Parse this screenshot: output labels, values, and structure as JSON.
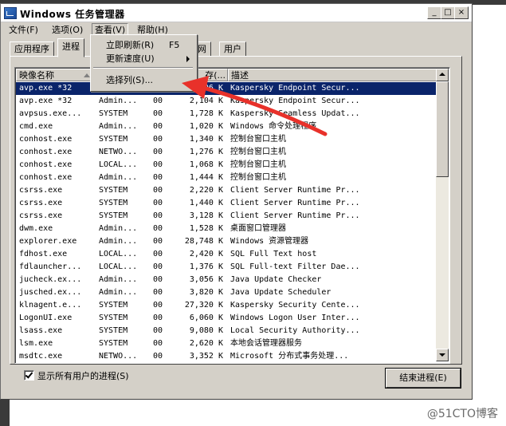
{
  "window": {
    "title": "Windows 任务管理器",
    "controls": {
      "minimize": "_",
      "maximize": "□",
      "close": "×"
    }
  },
  "menubar": [
    {
      "label": "文件(F)"
    },
    {
      "label": "选项(O)"
    },
    {
      "label": "查看(V)"
    },
    {
      "label": "帮助(H)"
    }
  ],
  "view_menu": {
    "refresh_label": "立即刷新(R)",
    "refresh_shortcut": "F5",
    "speed_label": "更新速度(U)",
    "select_columns_label": "选择列(S)..."
  },
  "tabs": [
    {
      "label": "应用程序"
    },
    {
      "label": "进程"
    },
    {
      "label": "网"
    },
    {
      "label": "用户"
    }
  ],
  "columns": {
    "name": "映像名称",
    "memory": "存(...",
    "description": "描述"
  },
  "rows": [
    {
      "name": "avp.exe *32",
      "user": "SYSTEM",
      "cpu": "00",
      "mem": "...,206 K",
      "desc": "Kaspersky Endpoint Secur..."
    },
    {
      "name": "avp.exe *32",
      "user": "Admin...",
      "cpu": "00",
      "mem": "2,104 K",
      "desc": "Kaspersky Endpoint Secur..."
    },
    {
      "name": "avpsus.exe...",
      "user": "SYSTEM",
      "cpu": "00",
      "mem": "1,728 K",
      "desc": "Kaspersky Seamless Updat..."
    },
    {
      "name": "cmd.exe",
      "user": "Admin...",
      "cpu": "00",
      "mem": "1,020 K",
      "desc": "Windows 命令处理程序"
    },
    {
      "name": "conhost.exe",
      "user": "SYSTEM",
      "cpu": "00",
      "mem": "1,340 K",
      "desc": "控制台窗口主机"
    },
    {
      "name": "conhost.exe",
      "user": "NETWO...",
      "cpu": "00",
      "mem": "1,276 K",
      "desc": "控制台窗口主机"
    },
    {
      "name": "conhost.exe",
      "user": "LOCAL...",
      "cpu": "00",
      "mem": "1,068 K",
      "desc": "控制台窗口主机"
    },
    {
      "name": "conhost.exe",
      "user": "Admin...",
      "cpu": "00",
      "mem": "1,444 K",
      "desc": "控制台窗口主机"
    },
    {
      "name": "csrss.exe",
      "user": "SYSTEM",
      "cpu": "00",
      "mem": "2,220 K",
      "desc": "Client Server Runtime Pr..."
    },
    {
      "name": "csrss.exe",
      "user": "SYSTEM",
      "cpu": "00",
      "mem": "1,440 K",
      "desc": "Client Server Runtime Pr..."
    },
    {
      "name": "csrss.exe",
      "user": "SYSTEM",
      "cpu": "00",
      "mem": "3,128 K",
      "desc": "Client Server Runtime Pr..."
    },
    {
      "name": "dwm.exe",
      "user": "Admin...",
      "cpu": "00",
      "mem": "1,528 K",
      "desc": "桌面窗口管理器"
    },
    {
      "name": "explorer.exe",
      "user": "Admin...",
      "cpu": "00",
      "mem": "28,748 K",
      "desc": "Windows 资源管理器"
    },
    {
      "name": "fdhost.exe",
      "user": "LOCAL...",
      "cpu": "00",
      "mem": "2,420 K",
      "desc": "SQL Full Text host"
    },
    {
      "name": "fdlauncher...",
      "user": "LOCAL...",
      "cpu": "00",
      "mem": "1,376 K",
      "desc": "SQL Full-text Filter Dae..."
    },
    {
      "name": "jucheck.ex...",
      "user": "Admin...",
      "cpu": "00",
      "mem": "3,056 K",
      "desc": "Java Update Checker"
    },
    {
      "name": "jusched.ex...",
      "user": "Admin...",
      "cpu": "00",
      "mem": "3,820 K",
      "desc": "Java Update Scheduler"
    },
    {
      "name": "klnagent.e...",
      "user": "SYSTEM",
      "cpu": "00",
      "mem": "27,320 K",
      "desc": "Kaspersky Security Cente..."
    },
    {
      "name": "LogonUI.exe",
      "user": "SYSTEM",
      "cpu": "00",
      "mem": "6,060 K",
      "desc": "Windows Logon User Inter..."
    },
    {
      "name": "lsass.exe",
      "user": "SYSTEM",
      "cpu": "00",
      "mem": "9,080 K",
      "desc": "Local Security Authority..."
    },
    {
      "name": "lsm.exe",
      "user": "SYSTEM",
      "cpu": "00",
      "mem": "2,620 K",
      "desc": "本地会话管理器服务"
    },
    {
      "name": "msdtc.exe",
      "user": "NETWO...",
      "cpu": "00",
      "mem": "3,352 K",
      "desc": "Microsoft 分布式事务处理..."
    }
  ],
  "show_all_users": {
    "label": "显示所有用户的进程(S)",
    "checked": true
  },
  "end_process_label": "结束进程(E)",
  "watermark": "@51CTO博客",
  "colors": {
    "selection": "#0a246a",
    "annotation_arrow": "#e8312a",
    "face": "#d4d0c8"
  }
}
